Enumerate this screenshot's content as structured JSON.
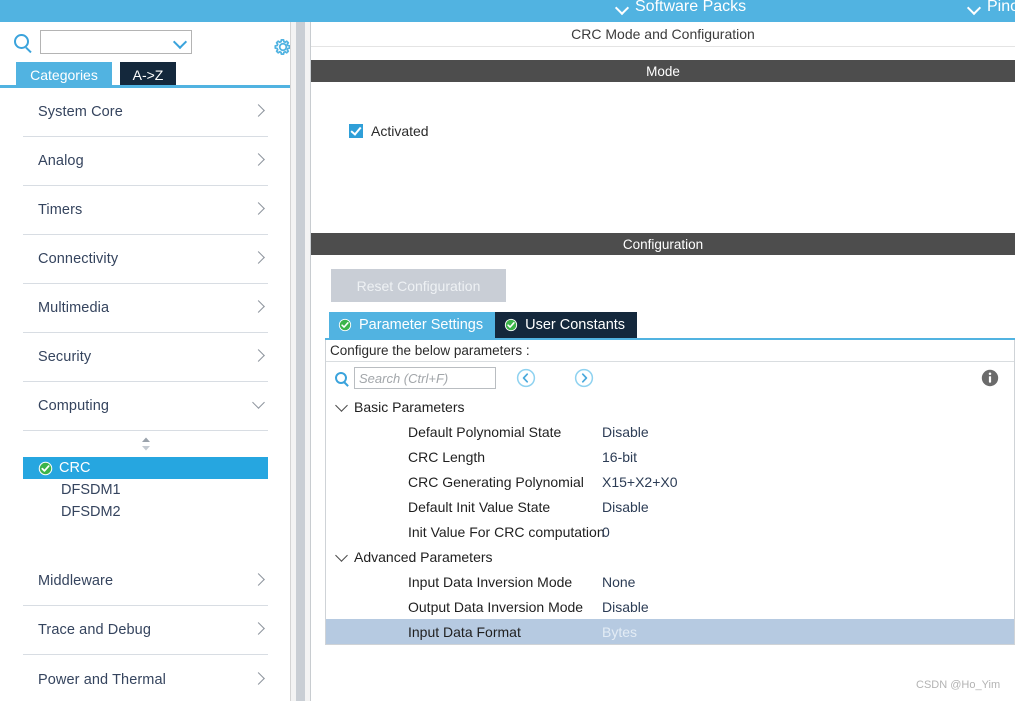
{
  "topbar": {
    "items": [
      {
        "label": "Software Packs",
        "icon": "chevron-down-icon"
      },
      {
        "label": "Pinout",
        "icon": "chevron-down-icon"
      }
    ]
  },
  "sidebar": {
    "search": {
      "value": "",
      "placeholder": ""
    },
    "gear_icon": "gear-icon",
    "tabs": [
      {
        "label": "Categories",
        "active": true
      },
      {
        "label": "A->Z",
        "active": false
      }
    ],
    "categories": [
      {
        "label": "System Core",
        "expanded": false
      },
      {
        "label": "Analog",
        "expanded": false
      },
      {
        "label": "Timers",
        "expanded": false
      },
      {
        "label": "Connectivity",
        "expanded": false
      },
      {
        "label": "Multimedia",
        "expanded": false
      },
      {
        "label": "Security",
        "expanded": false
      },
      {
        "label": "Computing",
        "expanded": true
      }
    ],
    "computing_items": [
      {
        "label": "CRC",
        "selected": true,
        "checked": true
      },
      {
        "label": "DFSDM1",
        "selected": false,
        "checked": false
      },
      {
        "label": "DFSDM2",
        "selected": false,
        "checked": false
      }
    ],
    "categories_after": [
      {
        "label": "Middleware",
        "expanded": false
      },
      {
        "label": "Trace and Debug",
        "expanded": false
      },
      {
        "label": "Power and Thermal",
        "expanded": false
      }
    ]
  },
  "content": {
    "title": "CRC Mode and Configuration",
    "mode": {
      "band": "Mode",
      "checkbox": {
        "label": "Activated",
        "checked": true
      }
    },
    "configuration": {
      "band": "Configuration",
      "reset_button": "Reset Configuration",
      "tabs": [
        {
          "label": "Parameter Settings",
          "active": true,
          "icon": "check-circle-icon"
        },
        {
          "label": "User Constants",
          "active": false,
          "icon": "check-circle-icon"
        }
      ],
      "configure_hint": "Configure the below parameters :",
      "search": {
        "value": "",
        "placeholder": "Search (Ctrl+F)"
      },
      "prev_icon": "circle-left-arrow-icon",
      "next_icon": "circle-right-arrow-icon",
      "info_icon": "info-icon",
      "groups": [
        {
          "label": "Basic Parameters",
          "expanded": true,
          "rows": [
            {
              "name": "Default Polynomial State",
              "value": "Disable",
              "selected": false
            },
            {
              "name": "CRC Length",
              "value": "16-bit",
              "selected": false
            },
            {
              "name": "CRC Generating Polynomial",
              "value": "X15+X2+X0",
              "selected": false
            },
            {
              "name": "Default Init Value State",
              "value": "Disable",
              "selected": false
            },
            {
              "name": "Init Value For CRC computation",
              "value": "0",
              "selected": false
            }
          ]
        },
        {
          "label": "Advanced Parameters",
          "expanded": true,
          "rows": [
            {
              "name": "Input Data Inversion Mode",
              "value": "None",
              "selected": false
            },
            {
              "name": "Output Data Inversion Mode",
              "value": "Disable",
              "selected": false
            },
            {
              "name": "Input Data Format",
              "value": "Bytes",
              "selected": true
            }
          ]
        }
      ]
    }
  },
  "watermark": "CSDN @Ho_Yim",
  "colors": {
    "accent_blue": "#51b3e1",
    "dark_navy": "#14283c",
    "band_gray": "#4d4d4d",
    "selection_blue": "#26a6e0",
    "row_highlight": "#b6cae1",
    "check_green": "#3cb44a"
  }
}
